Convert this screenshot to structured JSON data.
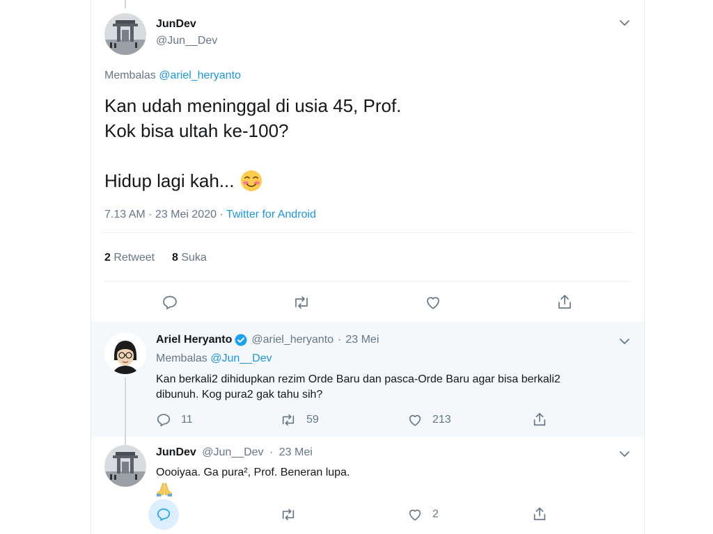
{
  "main_tweet": {
    "display_name": "JunDev",
    "handle": "@Jun__Dev",
    "replying_prefix": "Membalas",
    "replying_to": "@ariel_heryanto",
    "text_line1": "Kan udah meninggal di usia 45, Prof.",
    "text_line2": "Kok bisa ultah ke-100?",
    "text_line3": "Hidup lagi kah...",
    "emoji": "☺️",
    "time": "7.13 AM · 23 Mei 2020 · ",
    "source": "Twitter for Android",
    "retweet_count": "2",
    "retweet_label": "Retweet",
    "like_count": "8",
    "like_label": "Suka"
  },
  "reply1": {
    "display_name": "Ariel Heryanto",
    "handle": "@ariel_heryanto",
    "dot": "·",
    "date": "23 Mei",
    "replying_prefix": "Membalas",
    "replying_to": "@Jun__Dev",
    "text_line1": "Kan berkali2 dihidupkan rezim Orde Baru dan pasca-Orde Baru agar bisa berkali2",
    "text_line2": "dibunuh. Kog pura2 gak tahu sih?",
    "reply_count": "11",
    "retweet_count": "59",
    "like_count": "213"
  },
  "reply2": {
    "display_name": "JunDev",
    "handle": "@Jun__Dev",
    "dot": "·",
    "date": "23 Mei",
    "text_line1": "Oooiyaa. Ga pura², Prof. Beneran lupa.",
    "emoji": "🙏",
    "like_count": "2"
  },
  "colors": {
    "accent": "#1da1f2",
    "muted": "#657786",
    "text": "#14171a",
    "verified": "#1da1f2",
    "highlight_bg": "#f5f8fa"
  },
  "icons": [
    "chevron-down-icon",
    "reply-icon",
    "retweet-icon",
    "like-icon",
    "share-icon",
    "verified-badge-icon",
    "emoji-smile-icon",
    "emoji-pray-icon"
  ]
}
